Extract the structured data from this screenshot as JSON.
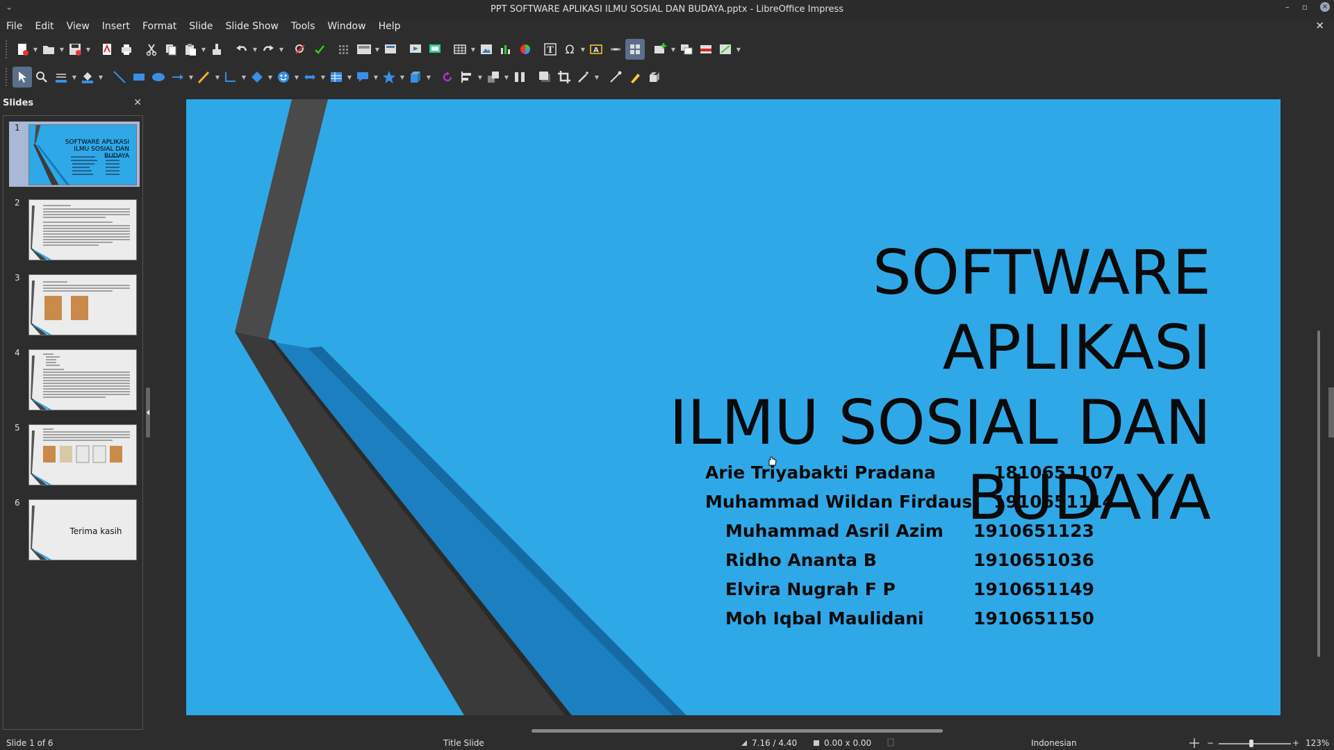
{
  "window": {
    "title": "PPT SOFTWARE APLIKASI ILMU SOSIAL DAN BUDAYA.pptx - LibreOffice Impress",
    "controls": [
      "–",
      "▫",
      "✕"
    ]
  },
  "menu": {
    "items": [
      "File",
      "Edit",
      "View",
      "Insert",
      "Format",
      "Slide",
      "Slide Show",
      "Tools",
      "Window",
      "Help"
    ],
    "close_doc": "✕"
  },
  "slides_pane": {
    "title": "Slides",
    "close": "✕",
    "thumbnails": [
      {
        "number": "1",
        "title_lines": [
          "SOFTWARE APLIKASI",
          "ILMU SOSIAL DAN",
          "BUDAYA"
        ],
        "selected": true
      },
      {
        "number": "2"
      },
      {
        "number": "3"
      },
      {
        "number": "4"
      },
      {
        "number": "5"
      },
      {
        "number": "6",
        "text": "Terima kasih"
      }
    ]
  },
  "slide": {
    "title_lines": [
      "SOFTWARE APLIKASI",
      "ILMU SOSIAL DAN",
      "BUDAYA"
    ],
    "members": [
      {
        "name": "Arie Triyabakti Pradana",
        "id": "1810651107"
      },
      {
        "name": "Muhammad Wildan Firdausi",
        "id": "1910651114"
      },
      {
        "name": "Muhammad Asril Azim",
        "id": "1910651123"
      },
      {
        "name": "Ridho Ananta B",
        "id": "1910651036"
      },
      {
        "name": "Elvira Nugrah F P",
        "id": "1910651149"
      },
      {
        "name": "Moh Iqbal Maulidani",
        "id": "1910651150"
      }
    ],
    "background_color": "#2fa8e8"
  },
  "status": {
    "slide_indicator": "Slide 1 of 6",
    "layout": "Title Slide",
    "position": "7.16 / 4.40",
    "size": "0.00 x 0.00",
    "language": "Indonesian",
    "zoom_minus": "−",
    "zoom_plus": "+",
    "zoom": "123%"
  }
}
